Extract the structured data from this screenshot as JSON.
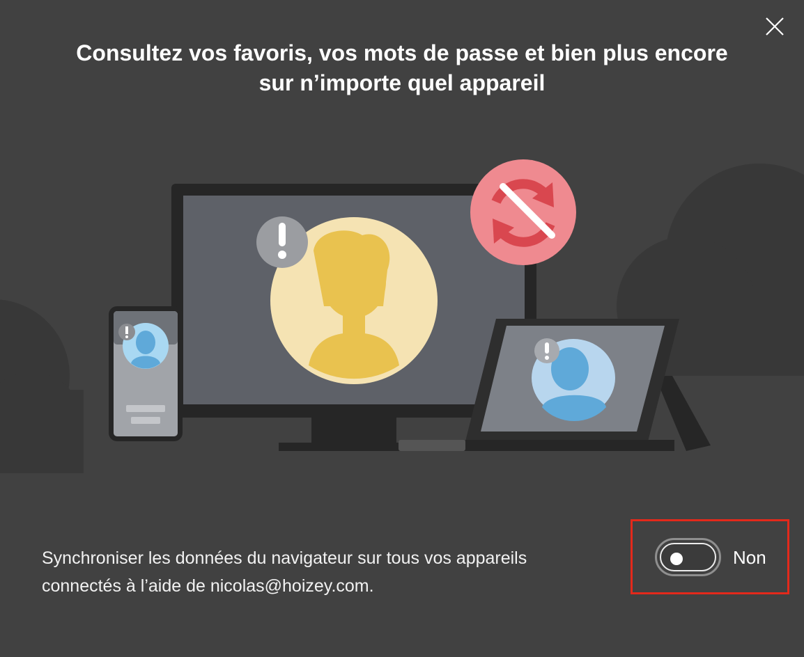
{
  "dialog": {
    "title_line1": "Consultez vos favoris, vos mots de passe et bien plus encore",
    "title_line2": "sur n’importe quel appareil",
    "close_icon": "close-icon"
  },
  "illustration": {
    "icons": [
      "monitor-icon",
      "phone-icon",
      "tablet-icon",
      "sync-off-icon",
      "warning-icon",
      "user-avatar-icon"
    ]
  },
  "sync": {
    "description_line1": "Synchroniser les données du navigateur sur tous vos appareils",
    "description_line2": "connectés à l’aide de nicolas@hoizey.com.",
    "toggle_state": "off",
    "toggle_label": "Non"
  },
  "colors": {
    "background": "#414141",
    "highlight": "#e3291b",
    "sync_off_badge": "#ef8a90",
    "avatar_yellow": "#e9c24f",
    "avatar_blue": "#5fa9d9"
  }
}
